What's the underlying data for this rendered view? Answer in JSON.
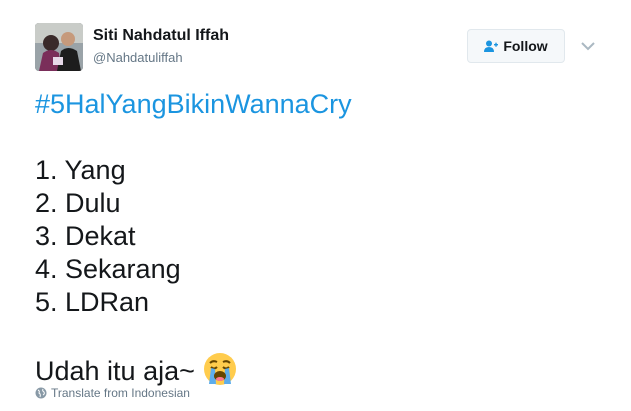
{
  "user": {
    "display_name": "Siti Nahdatul Iffah",
    "handle": "@Nahdatuliffah"
  },
  "header": {
    "follow_label": "Follow"
  },
  "tweet": {
    "hashtag": "#5HalYangBikinWannaCry",
    "list_items": [
      "1. Yang",
      "2. Dulu",
      "3. Dekat",
      "4. Sekarang",
      "5. LDRan"
    ],
    "closing": "Udah itu aja~",
    "emoji": "loudly-crying-face-icon"
  },
  "footer": {
    "translate_label": "Translate from Indonesian"
  },
  "colors": {
    "link": "#1b95e0",
    "secondary_text": "#657786",
    "primary_text": "#14171a"
  }
}
